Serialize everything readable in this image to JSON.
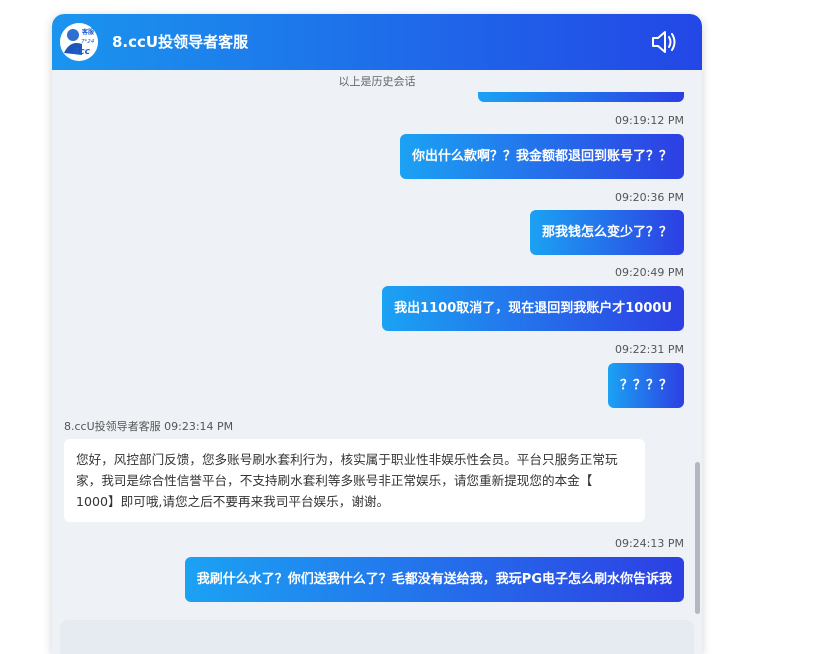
{
  "header": {
    "title": "8.ccU投领导者客服",
    "avatar_text_top": "客服",
    "avatar_text_mid": "7*24",
    "avatar_text_bottom": "8cc",
    "sound_icon": "speaker-icon"
  },
  "history_note": "以上是历史会话",
  "messages": [
    {
      "timestamp": "09:19:12 PM",
      "text": "你出什么款啊？？我金额都退回到账号了？？"
    },
    {
      "timestamp": "09:20:36 PM",
      "text": "那我钱怎么变少了？？"
    },
    {
      "timestamp": "09:20:49 PM",
      "text": "我出1100取消了，现在退回到我账户才1000U"
    },
    {
      "timestamp": "09:22:31 PM",
      "text": "？？？？"
    }
  ],
  "agent_message": {
    "sender": "8.ccU投领导者客服 09:23:14 PM",
    "text": "您好，风控部门反馈，您多账号刷水套利行为，核实属于职业性非娱乐性会员。平台只服务正常玩家，我司是综合性信誉平台，不支持刷水套利等多账号非正常娱乐，请您重新提现您的本金【 1000】即可哦,请您之后不要再来我司平台娱乐，谢谢。"
  },
  "last_message": {
    "timestamp": "09:24:13 PM",
    "text": "我刷什么水了？你们送我什么了？毛都没有送给我，我玩PG电子怎么刷水你告诉我"
  },
  "colors": {
    "header_start": "#1a95ee",
    "header_end": "#2347e6",
    "bubble_start": "#1ba2f3",
    "bubble_end": "#2d3fe3"
  }
}
